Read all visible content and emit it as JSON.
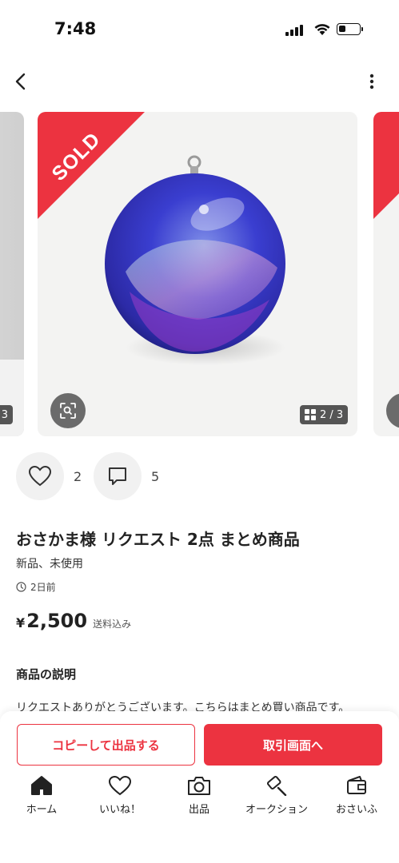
{
  "status_bar": {
    "time": "7:48"
  },
  "item": {
    "sold_label": "SOLD",
    "photo_counter": "2 / 3",
    "prev_photo_counter": "3",
    "likes": "2",
    "comments": "5",
    "title": "おさかま様 リクエスト 2点 まとめ商品",
    "condition": "新品、未使用",
    "posted": "2日前",
    "price_symbol": "¥",
    "price": "2,500",
    "price_note": "送料込み",
    "description_heading": "商品の説明",
    "description": "リクエストありがとうございます。こちらはまとめ買い商品です。"
  },
  "buttons": {
    "copy_listing": "コピーして出品する",
    "go_to_trade": "取引画面へ"
  },
  "tabs": [
    {
      "label": "ホーム",
      "icon": "home-icon"
    },
    {
      "label": "いいね！",
      "icon": "heart-icon"
    },
    {
      "label": "出品",
      "icon": "camera-icon"
    },
    {
      "label": "オークション",
      "icon": "auction-hammer-icon"
    },
    {
      "label": "おさいふ",
      "icon": "wallet-icon"
    }
  ],
  "colors": {
    "accent_red": "#ec3340",
    "text_dark": "#222222",
    "chip_gray": "#f1f1f1"
  },
  "battery_level": 0.35
}
